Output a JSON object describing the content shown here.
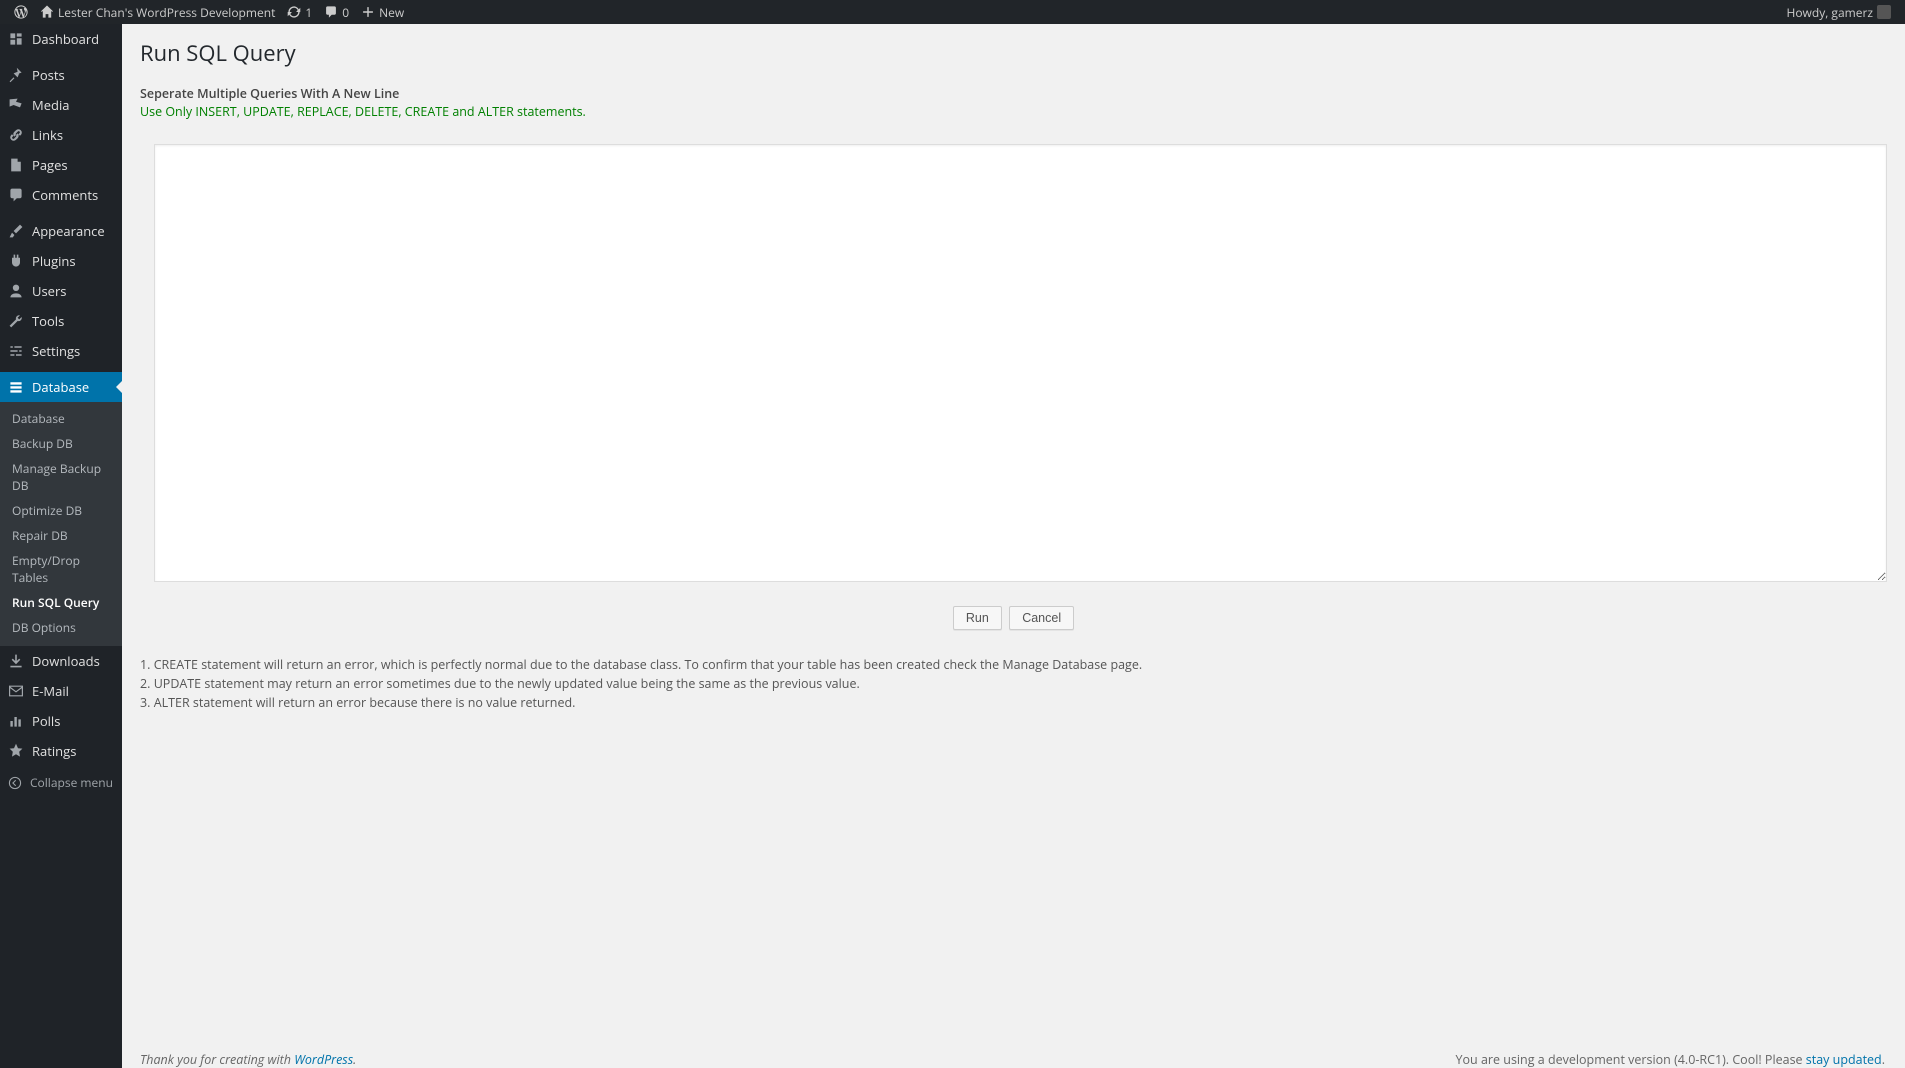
{
  "adminbar": {
    "site_title": "Lester Chan's WordPress Development",
    "updates_count": "1",
    "comments_count": "0",
    "new_label": "New",
    "howdy": "Howdy, gamerz"
  },
  "sidebar": {
    "items": [
      {
        "name": "dashboard",
        "label": "Dashboard"
      },
      {
        "name": "posts",
        "label": "Posts"
      },
      {
        "name": "media",
        "label": "Media"
      },
      {
        "name": "links",
        "label": "Links"
      },
      {
        "name": "pages",
        "label": "Pages"
      },
      {
        "name": "comments",
        "label": "Comments"
      },
      {
        "name": "appearance",
        "label": "Appearance"
      },
      {
        "name": "plugins",
        "label": "Plugins"
      },
      {
        "name": "users",
        "label": "Users"
      },
      {
        "name": "tools",
        "label": "Tools"
      },
      {
        "name": "settings",
        "label": "Settings"
      },
      {
        "name": "database",
        "label": "Database"
      },
      {
        "name": "downloads",
        "label": "Downloads"
      },
      {
        "name": "email",
        "label": "E-Mail"
      },
      {
        "name": "polls",
        "label": "Polls"
      },
      {
        "name": "ratings",
        "label": "Ratings"
      }
    ],
    "submenu_database": [
      {
        "label": "Database"
      },
      {
        "label": "Backup DB"
      },
      {
        "label": "Manage Backup DB"
      },
      {
        "label": "Optimize DB"
      },
      {
        "label": "Repair DB"
      },
      {
        "label": "Empty/Drop Tables"
      },
      {
        "label": "Run SQL Query",
        "current": true
      },
      {
        "label": "DB Options"
      }
    ],
    "collapse_label": "Collapse menu"
  },
  "page": {
    "title": "Run SQL Query",
    "instruction_strong": "Seperate Multiple Queries With A New Line",
    "instruction_green": "Use Only INSERT, UPDATE, REPLACE, DELETE, CREATE and ALTER statements.",
    "sql_value": "",
    "run_label": "Run",
    "cancel_label": "Cancel",
    "notes": [
      "CREATE statement will return an error, which is perfectly normal due to the database class. To confirm that your table has been created check the Manage Database page.",
      "UPDATE statement may return an error sometimes due to the newly updated value being the same as the previous value.",
      "ALTER statement will return an error because there is no value returned."
    ],
    "footer_left_prefix": "Thank you for creating with ",
    "footer_left_link": "WordPress",
    "footer_left_suffix": ".",
    "footer_right_prefix": "You are using a development version (4.0-RC1). Cool! Please ",
    "footer_right_link": "stay updated",
    "footer_right_suffix": "."
  }
}
